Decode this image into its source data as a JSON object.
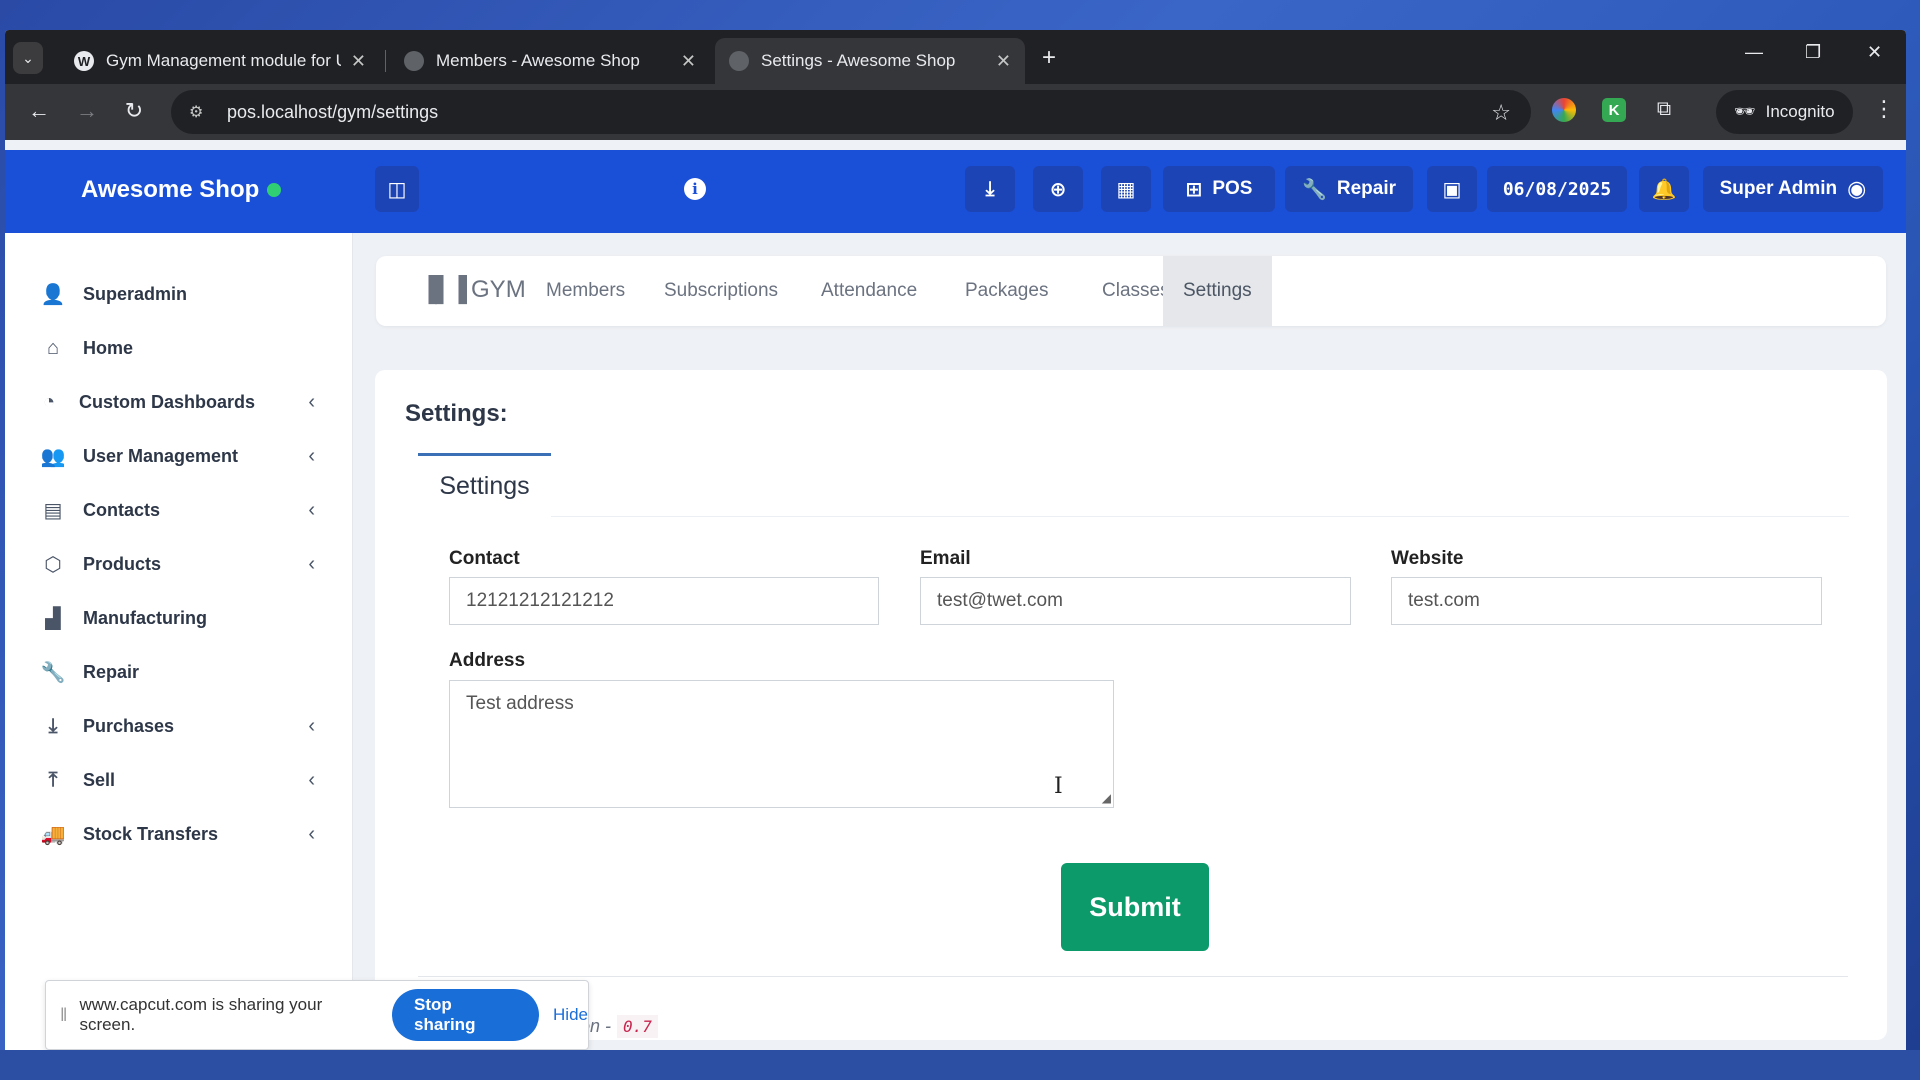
{
  "browser": {
    "tabs": [
      {
        "title": "Gym Management module for U",
        "active": false
      },
      {
        "title": "Members - Awesome Shop",
        "active": false
      },
      {
        "title": "Settings - Awesome Shop",
        "active": true
      }
    ],
    "url": "pos.localhost/gym/settings",
    "incognito_label": "Incognito"
  },
  "header": {
    "brand": "Awesome Shop",
    "pos_label": "POS",
    "repair_label": "Repair",
    "date": "06/08/2025",
    "user": "Super Admin",
    "status_color": "#2fcf72",
    "accent": "#1a4fd8"
  },
  "sidebar": {
    "items": [
      {
        "label": "Superadmin",
        "icon": "user-gear-icon",
        "has_children": false
      },
      {
        "label": "Home",
        "icon": "home-icon",
        "has_children": false
      },
      {
        "label": "Custom Dashboards",
        "icon": "dashboard-gauge-icon",
        "has_children": true
      },
      {
        "label": "User Management",
        "icon": "users-icon",
        "has_children": true
      },
      {
        "label": "Contacts",
        "icon": "contact-card-icon",
        "has_children": true
      },
      {
        "label": "Products",
        "icon": "box-icon",
        "has_children": true
      },
      {
        "label": "Manufacturing",
        "icon": "factory-icon",
        "has_children": false
      },
      {
        "label": "Repair",
        "icon": "wrench-icon",
        "has_children": false
      },
      {
        "label": "Purchases",
        "icon": "download-arrow-icon",
        "has_children": true
      },
      {
        "label": "Sell",
        "icon": "upload-arrow-icon",
        "has_children": true
      },
      {
        "label": "Stock Transfers",
        "icon": "truck-icon",
        "has_children": true
      }
    ]
  },
  "gymnav": {
    "logo": "GYM",
    "tabs": [
      "Members",
      "Subscriptions",
      "Attendance",
      "Packages",
      "Classes",
      "Settings"
    ],
    "active": "Settings"
  },
  "settings": {
    "heading": "Settings:",
    "tab": "Settings",
    "contact_label": "Contact",
    "contact_value": "12121212121212",
    "email_label": "Email",
    "email_value": "test@twet.com",
    "website_label": "Website",
    "website_value": "test.com",
    "address_label": "Address",
    "address_value": "Test address",
    "submit_label": "Submit",
    "version_text": "on -",
    "version_value": "0.7"
  },
  "sharing": {
    "message": "www.capcut.com is sharing your screen.",
    "stop_label": "Stop sharing",
    "hide_label": "Hide"
  }
}
